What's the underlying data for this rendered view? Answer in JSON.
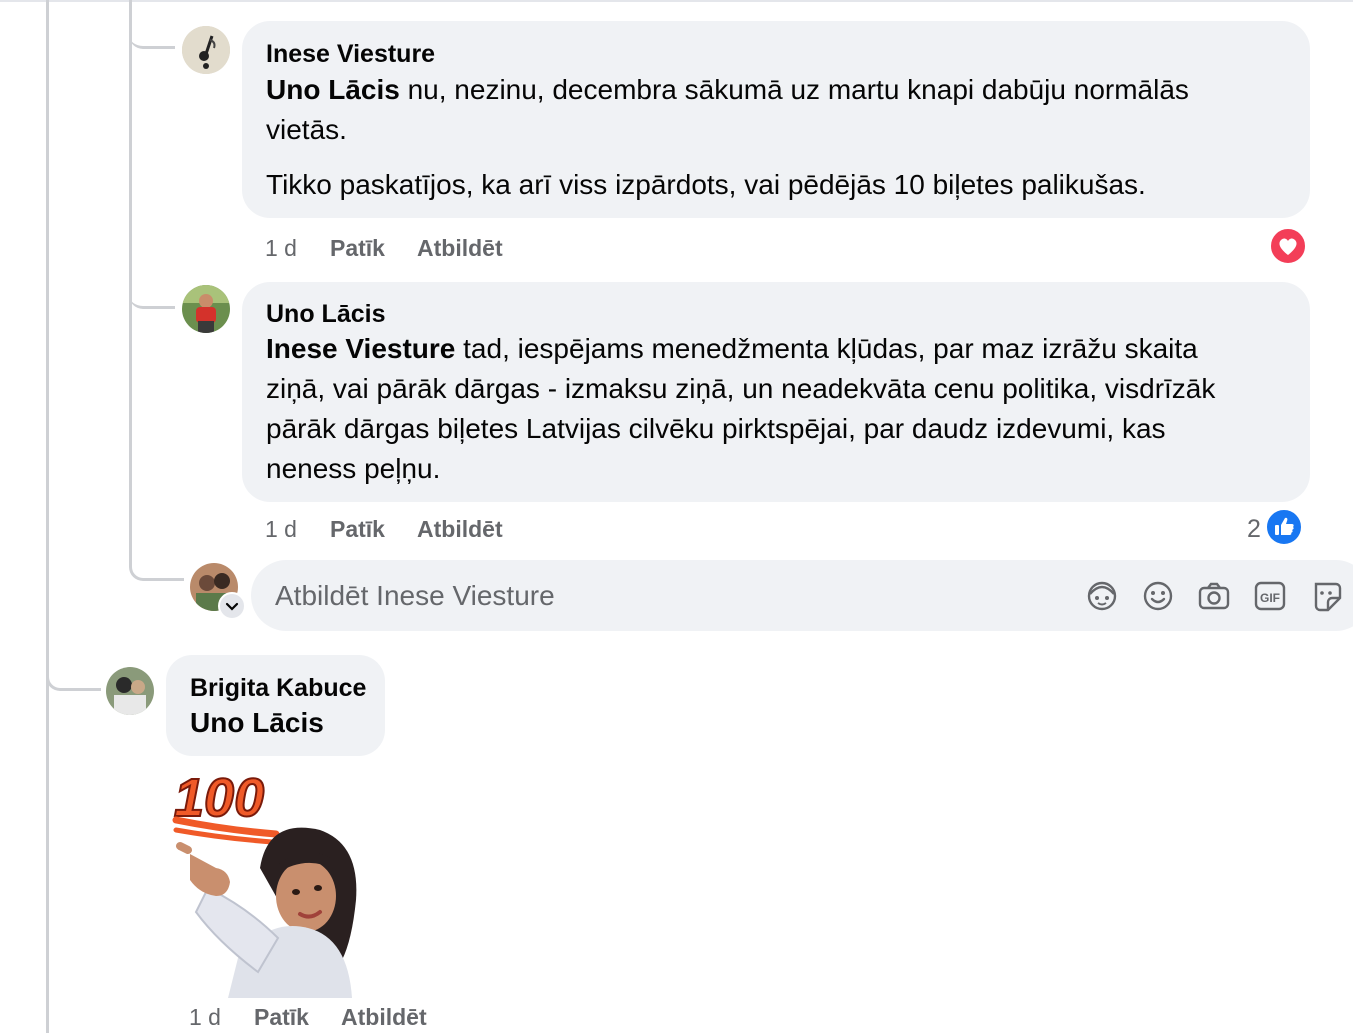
{
  "comments": [
    {
      "author": "Inese Viesture",
      "mention": "Uno Lācis",
      "text_line1": " nu, nezinu, decembra sākumā uz martu knapi dabūju normālās",
      "text_line2": "vietās.",
      "text_para2": "Tikko paskatījos, ka arī viss izpārdots, vai pēdējās 10 biļetes palikušas.",
      "time": "1 d",
      "like_label": "Patīk",
      "reply_label": "Atbildēt",
      "reaction_icon": "heart-reaction-icon"
    },
    {
      "author": "Uno Lācis",
      "mention": "Inese Viesture",
      "text_line1": " tad, iespējams menedžmenta kļūdas, par maz izrāžu skaita",
      "text_line2": "ziņā, vai pārāk dārgas - izmaksu ziņā, un neadekvāta cenu politika, visdrīzāk",
      "text_line3": "pārāk dārgas biļetes Latvijas cilvēku pirktspējai, par daudz izdevumi, kas",
      "text_line4": "neness peļņu.",
      "time": "1 d",
      "like_label": "Patīk",
      "reply_label": "Atbildēt",
      "reaction_count": "2",
      "reaction_icon": "like-reaction-icon"
    }
  ],
  "reply_input": {
    "placeholder": "Atbildēt Inese Viesture",
    "tools": [
      "avatar-sticker-icon",
      "emoji-icon",
      "camera-icon",
      "gif-icon",
      "sticker-icon"
    ],
    "gif_label": "GIF"
  },
  "bottom_comment": {
    "author": "Brigita Kabuce",
    "mention": "Uno Lācis",
    "sticker_text": "100",
    "time": "1 d",
    "like_label": "Patīk",
    "reply_label": "Atbildēt"
  },
  "colors": {
    "bubble": "#f0f2f5",
    "secondary_text": "#65676b",
    "like_blue": "#1877f2",
    "heart_red": "#f33e58",
    "thread_line": "#ced0d4"
  }
}
